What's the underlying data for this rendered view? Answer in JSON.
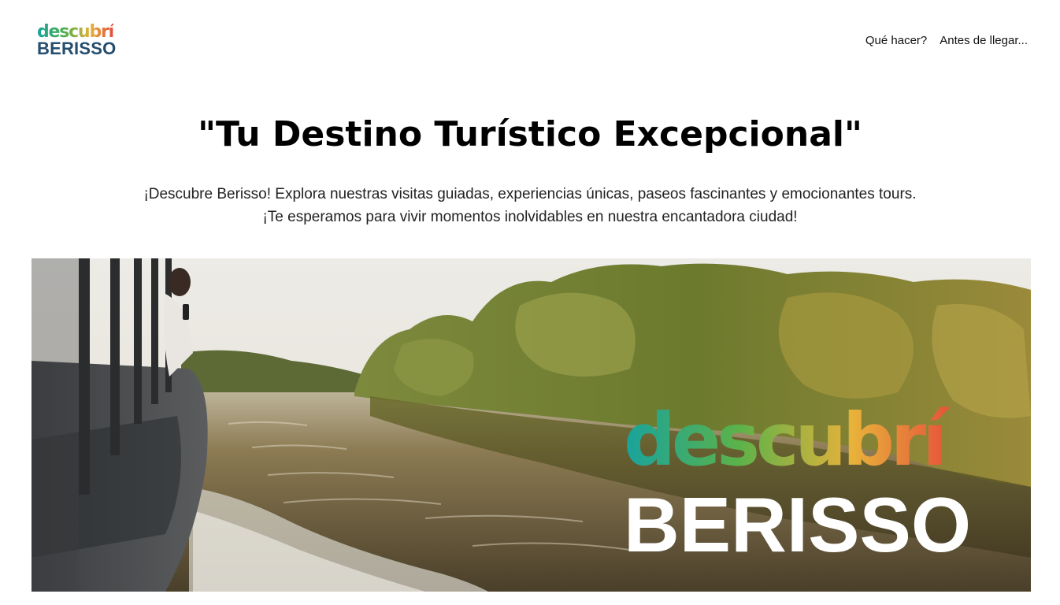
{
  "header": {
    "logo": {
      "top_text": "descubrí",
      "bottom_text": "BERISSO"
    },
    "nav": [
      {
        "label": "Qué hacer?"
      },
      {
        "label": "Antes de llegar..."
      }
    ]
  },
  "hero": {
    "title": "\"Tu Destino Turístico Excepcional\"",
    "subtitle_line1": "¡Descubre Berisso! Explora nuestras visitas guiadas, experiencias únicas, paseos fascinantes y emocionantes tours.",
    "subtitle_line2": "¡Te esperamos para vivir momentos inolvidables en nuestra encantadora ciudad!"
  },
  "banner": {
    "logo_top_text": "descubrí",
    "logo_bottom_text": "BERISSO"
  },
  "colors": {
    "logo_blue": "#244d6e",
    "gradient_teal": "#19a3a0",
    "gradient_green": "#4cae4f",
    "gradient_yellow": "#e6b13a",
    "gradient_red": "#e24b3b"
  }
}
